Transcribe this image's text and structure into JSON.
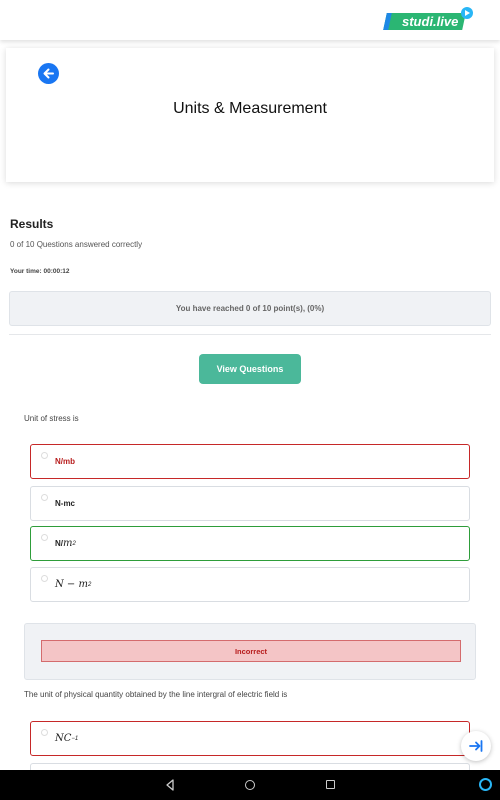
{
  "brand": {
    "logo_text": "studi.live"
  },
  "header": {
    "title": "Units & Measurement"
  },
  "results": {
    "heading": "Results",
    "answered": "0 of 10 Questions answered correctly",
    "time": "Your time: 00:00:12",
    "points": "You have reached 0 of 10 point(s), (0%)",
    "view_button": "View Questions"
  },
  "questions": [
    {
      "text": "Unit of  stress is",
      "options": [
        {
          "label": "N/mb",
          "state": "wrong"
        },
        {
          "label": "N-mc",
          "state": "normal"
        },
        {
          "label_prefix": "N/",
          "base": "m",
          "exp": "2",
          "state": "right"
        },
        {
          "base": "N − m",
          "exp": "2",
          "state": "normal"
        }
      ],
      "result": "Incorrect"
    },
    {
      "text": "The unit of physical quantity obtained by the line intergral of electric field is",
      "options": [
        {
          "base": "NC",
          "exp": "−1",
          "state": "wrong"
        }
      ]
    }
  ],
  "colors": {
    "accent_green": "#4bb89a",
    "wrong": "#c62828",
    "right": "#2e9d3a",
    "primary_blue": "#1976f2"
  },
  "icons": [
    "back-arrow-icon",
    "play-icon",
    "exit-arrow-icon",
    "nav-back-icon",
    "nav-home-icon",
    "nav-recent-icon",
    "assistant-icon"
  ]
}
